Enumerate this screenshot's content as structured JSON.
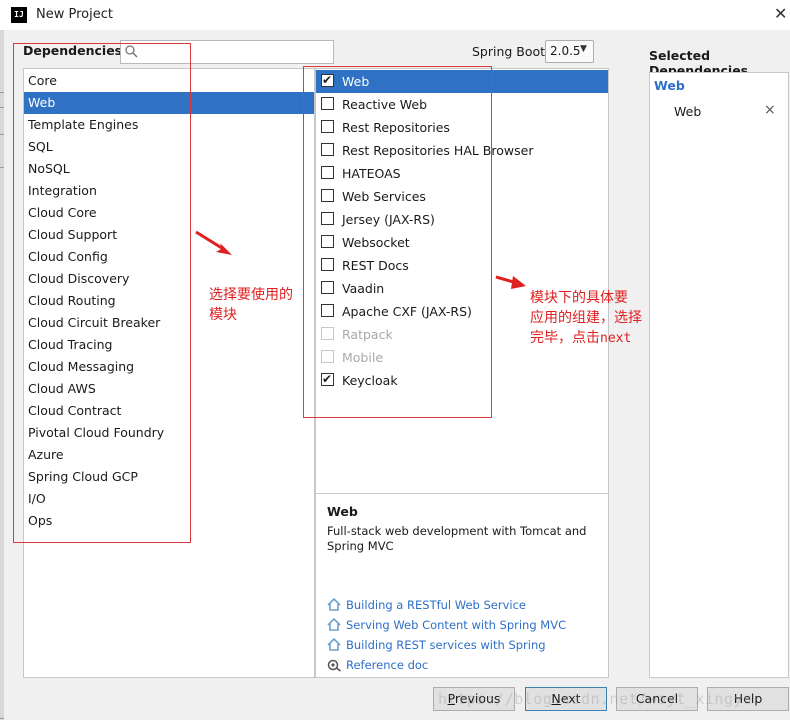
{
  "window": {
    "title": "New Project",
    "close_glyph": "✕",
    "app_icon": "intellij-icon",
    "app_icon_text": "IJ"
  },
  "dependencies": {
    "label": "Dependencies",
    "search": {
      "placeholder": "",
      "value": "",
      "icon": "search-icon"
    },
    "spring_boot_label": "Spring Boot",
    "spring_boot_version": "2.0.5",
    "categories": [
      "Core",
      "Web",
      "Template Engines",
      "SQL",
      "NoSQL",
      "Integration",
      "Cloud Core",
      "Cloud Support",
      "Cloud Config",
      "Cloud Discovery",
      "Cloud Routing",
      "Cloud Circuit Breaker",
      "Cloud Tracing",
      "Cloud Messaging",
      "Cloud AWS",
      "Cloud Contract",
      "Pivotal Cloud Foundry",
      "Azure",
      "Spring Cloud GCP",
      "I/O",
      "Ops"
    ],
    "selected_category": "Web",
    "modules": [
      {
        "label": "Web",
        "checked": true,
        "selected": true,
        "enabled": true
      },
      {
        "label": "Reactive Web",
        "checked": false,
        "selected": false,
        "enabled": true
      },
      {
        "label": "Rest Repositories",
        "checked": false,
        "selected": false,
        "enabled": true
      },
      {
        "label": "Rest Repositories HAL Browser",
        "checked": false,
        "selected": false,
        "enabled": true
      },
      {
        "label": "HATEOAS",
        "checked": false,
        "selected": false,
        "enabled": true
      },
      {
        "label": "Web Services",
        "checked": false,
        "selected": false,
        "enabled": true
      },
      {
        "label": "Jersey (JAX-RS)",
        "checked": false,
        "selected": false,
        "enabled": true
      },
      {
        "label": "Websocket",
        "checked": false,
        "selected": false,
        "enabled": true
      },
      {
        "label": "REST Docs",
        "checked": false,
        "selected": false,
        "enabled": true
      },
      {
        "label": "Vaadin",
        "checked": false,
        "selected": false,
        "enabled": true
      },
      {
        "label": "Apache CXF (JAX-RS)",
        "checked": false,
        "selected": false,
        "enabled": true
      },
      {
        "label": "Ratpack",
        "checked": false,
        "selected": false,
        "enabled": false
      },
      {
        "label": "Mobile",
        "checked": false,
        "selected": false,
        "enabled": false
      },
      {
        "label": "Keycloak",
        "checked": true,
        "selected": false,
        "enabled": true
      }
    ],
    "check_glyph": "✔"
  },
  "description": {
    "title": "Web",
    "text": "Full-stack web development with Tomcat and Spring MVC",
    "links": [
      {
        "label": "Building a RESTful Web Service",
        "icon": "guide-home-icon"
      },
      {
        "label": "Serving Web Content with Spring MVC",
        "icon": "guide-home-icon"
      },
      {
        "label": "Building REST services with Spring",
        "icon": "guide-home-icon"
      },
      {
        "label": "Reference doc",
        "icon": "reference-doc-icon"
      }
    ]
  },
  "selected_dependencies": {
    "title": "Selected Dependencies",
    "group": "Web",
    "items": [
      {
        "label": "Web",
        "remove_glyph": "×"
      }
    ]
  },
  "buttons": {
    "previous_mnemonic": "P",
    "previous_rest": "revious",
    "next_mnemonic": "N",
    "next_rest": "ext",
    "cancel": "Cancel",
    "help": "Help"
  },
  "annotations": {
    "left_note": "选择要使用的\n模块",
    "right_note_prefix": "模块下的具体要\n应用的组建，选择\n完毕，点击",
    "right_note_code": "next",
    "color": "#e02020"
  },
  "watermark": "https://blog.csdn.net/wayt_xingyu",
  "colors": {
    "selection": "#2f72c4",
    "link": "#2e6fc7",
    "annotation": "#d83b3b"
  }
}
